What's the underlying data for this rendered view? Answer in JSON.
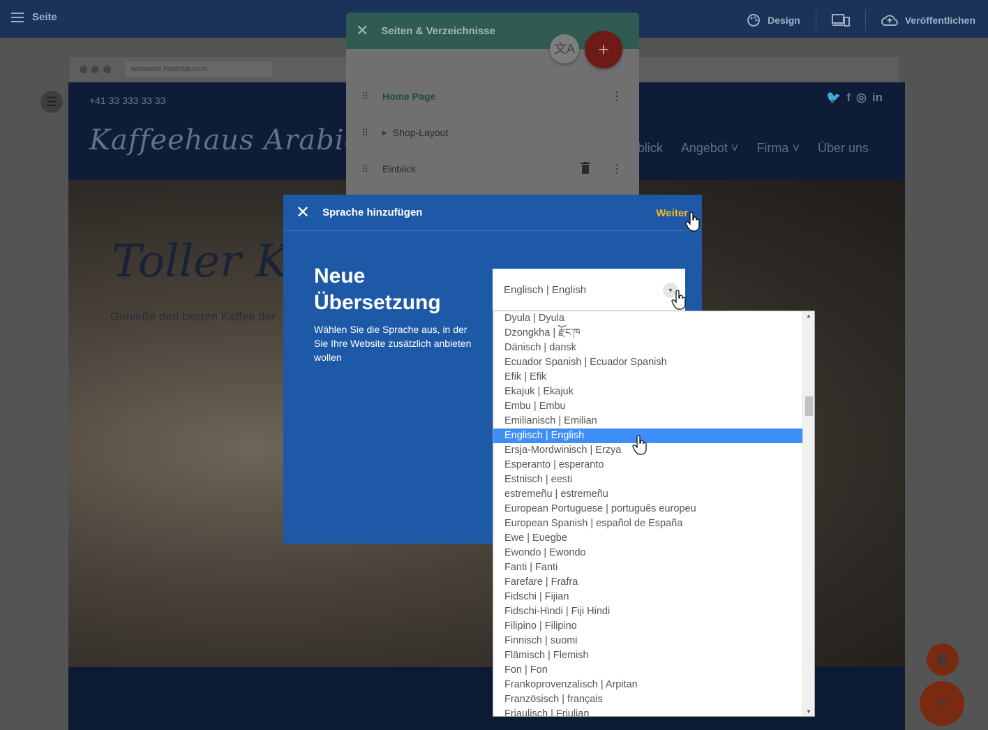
{
  "topbar": {
    "page_label": "Seite",
    "design_label": "Design",
    "publish_label": "Veröffentlichen"
  },
  "browser": {
    "url": "webseite.hoststar.com"
  },
  "site": {
    "phone": "+41 33 333 33 33",
    "logo": "Kaffeehaus Arabica",
    "nav": [
      "Einblick",
      "Angebot",
      "Firma",
      "Über uns"
    ],
    "hero_title": "Toller K",
    "hero_subtitle": "Genieße den besten Kaffee der"
  },
  "pages_panel": {
    "title": "Seiten & Verzeichnisse",
    "pages": [
      {
        "label": "Home Page",
        "is_home": true
      },
      {
        "label": "Shop-Layout",
        "is_home": false,
        "collapsible": true
      },
      {
        "label": "Einblick",
        "is_home": false,
        "deletable": true
      }
    ]
  },
  "dialog": {
    "title": "Sprache hinzufügen",
    "next_label": "Weiter",
    "heading": "Neue Übersetzung",
    "description": "Wählen Sie die Sprache aus, in der Sie Ihre Website zusätzlich anbieten wollen",
    "selected_language": "Englisch | English",
    "languages": [
      "Dyula | Dyula",
      "Dzongkha | རྫོང་ཁ",
      "Dänisch | dansk",
      "Ecuador Spanish | Ecuador Spanish",
      "Efik | Efik",
      "Ekajuk | Ekajuk",
      "Embu | Embu",
      "Emilianisch | Emilian",
      "Englisch | English",
      "Ersja-Mordwinisch | Erzya",
      "Esperanto | esperanto",
      "Estnisch | eesti",
      "estremeñu | estremeñu",
      "European Portuguese | português europeu",
      "European Spanish | español de España",
      "Ewe | Eʋegbe",
      "Ewondo | Ewondo",
      "Fanti | Fanti",
      "Farefare | Frafra",
      "Fidschi | Fijian",
      "Fidschi-Hindi | Fiji Hindi",
      "Filipino | Filipino",
      "Finnisch | suomi",
      "Flämisch | Flemish",
      "Fon | Fon",
      "Frankoprovenzalisch | Arpitan",
      "Französisch | français",
      "Friaulisch | Friulian"
    ]
  },
  "colors": {
    "dialog_blue": "#1e59a8",
    "accent_yellow": "#f2b82a",
    "selection_blue": "#3e8ef7",
    "panel_green": "#2f5b52",
    "fab_red": "#6e1a16"
  }
}
